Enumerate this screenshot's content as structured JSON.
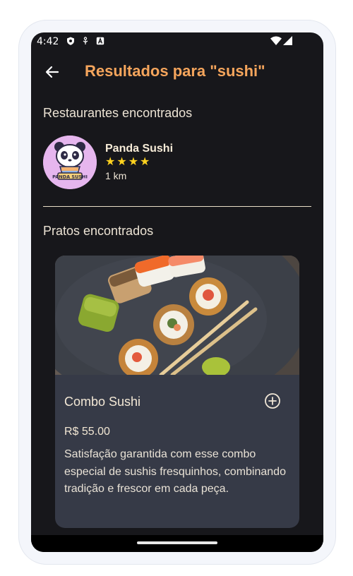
{
  "status_bar": {
    "time": "4:42",
    "left_icons": [
      "shield-icon",
      "usb-debug-icon",
      "app-a-icon"
    ],
    "right_icons": [
      "wifi-icon",
      "signal-icon"
    ]
  },
  "app_bar": {
    "back_icon": "arrow-left-icon",
    "title": "Resultados para \"sushi\"",
    "title_color": "#f5a55c"
  },
  "restaurants_section": {
    "label": "Restaurantes encontrados",
    "items": [
      {
        "name": "Panda Sushi",
        "rating_stars": 4,
        "distance": "1 km",
        "logo_text": "PANDA SUSHI"
      }
    ]
  },
  "dishes_section": {
    "label": "Pratos encontrados",
    "items": [
      {
        "name": "Combo Sushi",
        "price": "R$ 55.00",
        "description": "Satisfação garantida com esse combo especial de sushis fresquinhos, combinando tradição e frescor em cada peça.",
        "add_icon": "plus-circle-icon"
      }
    ]
  },
  "colors": {
    "background": "#17171b",
    "card": "#363a47",
    "star": "#ffd21f",
    "accent": "#f5a55c"
  }
}
